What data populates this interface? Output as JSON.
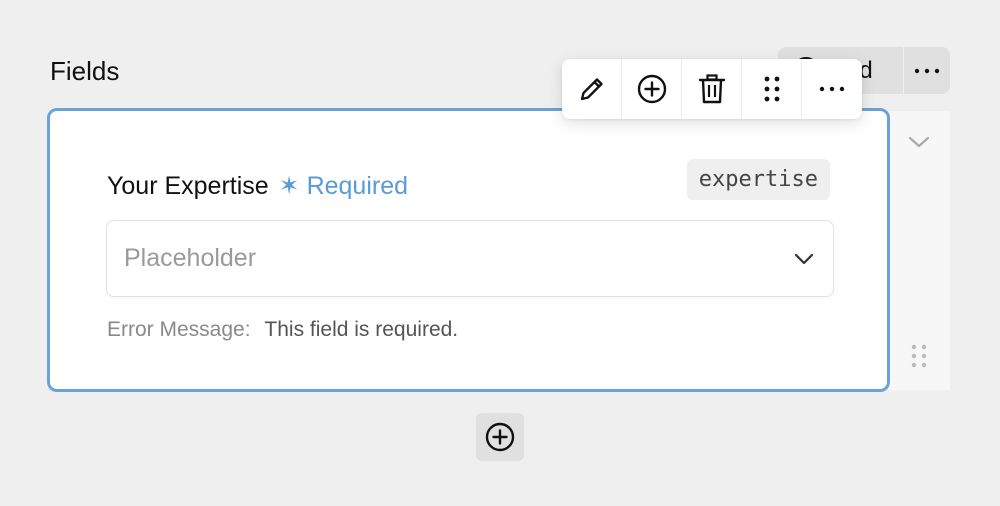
{
  "header": {
    "title": "Fields",
    "add_label": "Add"
  },
  "toolbar": {
    "items": [
      {
        "icon": "pencil-icon"
      },
      {
        "icon": "plus-circle-icon"
      },
      {
        "icon": "trash-icon"
      },
      {
        "icon": "drag-handle-icon"
      },
      {
        "icon": "more-horizontal-icon"
      }
    ]
  },
  "field": {
    "label": "Your Expertise",
    "required_label": "✶ Required",
    "key": "expertise",
    "placeholder": "Placeholder",
    "error_label": "Error Message:",
    "error_text": "This field is required."
  },
  "colors": {
    "accent": "#6aa3d9",
    "required": "#5b9bd5",
    "background": "#efefef"
  }
}
